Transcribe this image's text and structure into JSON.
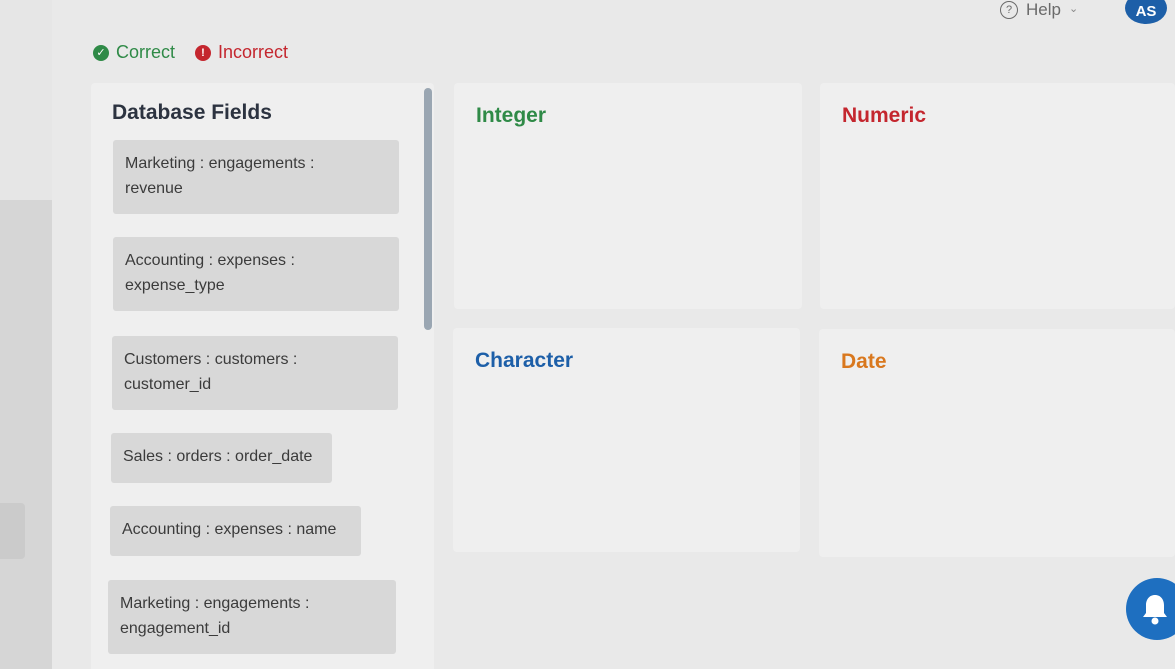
{
  "header": {
    "help_label": "Help",
    "help_icon": "question-circle-icon",
    "avatar_initials": "AS"
  },
  "legend": {
    "correct_label": "Correct",
    "incorrect_label": "Incorrect",
    "correct_color": "#2f8a47",
    "incorrect_color": "#c4262e"
  },
  "fields_panel": {
    "title": "Database Fields",
    "items": [
      {
        "line1": "Marketing : engagements :",
        "line2": "revenue"
      },
      {
        "line1": "Accounting : expenses :",
        "line2": "expense_type"
      },
      {
        "line1": "Customers : customers :",
        "line2": "customer_id"
      },
      {
        "line1": "Sales : orders : order_date",
        "line2": ""
      },
      {
        "line1": "Accounting : expenses : name",
        "line2": ""
      },
      {
        "line1": "Marketing : engagements :",
        "line2": "engagement_id"
      }
    ]
  },
  "zones": {
    "integer": {
      "title": "Integer",
      "color": "#2f8a47"
    },
    "numeric": {
      "title": "Numeric",
      "color": "#c4262e"
    },
    "character": {
      "title": "Character",
      "color": "#1d5fa8"
    },
    "date": {
      "title": "Date",
      "color": "#d9781e"
    }
  },
  "notification": {
    "icon": "bell-icon",
    "color": "#1e6fc0"
  }
}
